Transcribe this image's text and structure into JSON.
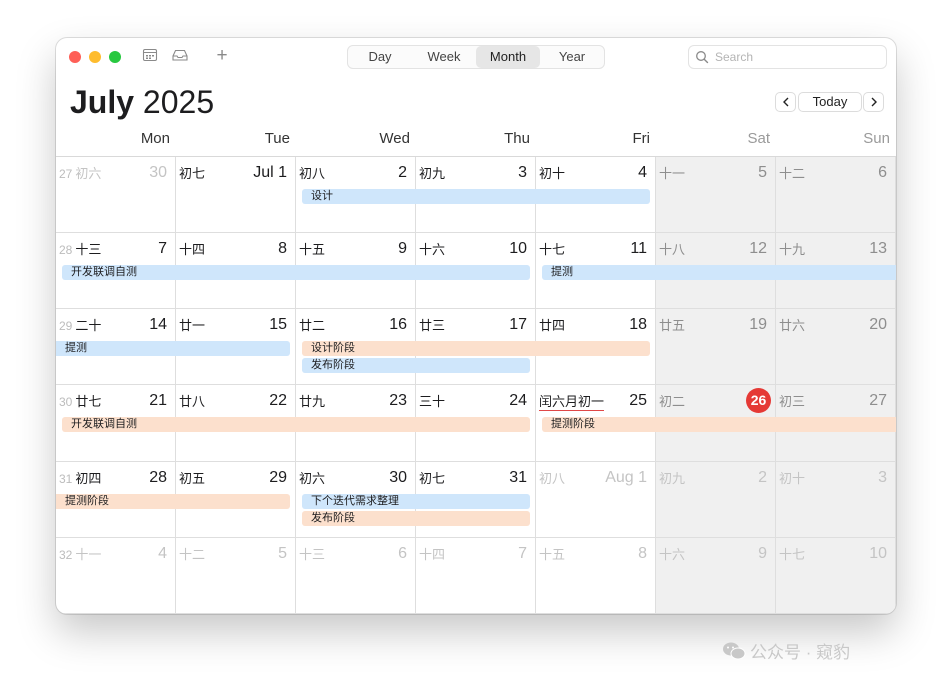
{
  "toolbar": {
    "views": [
      "Day",
      "Week",
      "Month",
      "Year"
    ],
    "active_view": "Month",
    "search_placeholder": "Search",
    "add_label": "+"
  },
  "header": {
    "month": "July",
    "year": "2025",
    "today_label": "Today"
  },
  "weekdays": [
    "Mon",
    "Tue",
    "Wed",
    "Thu",
    "Fri",
    "Sat",
    "Sun"
  ],
  "weeks": [
    {
      "week": "27",
      "days": [
        {
          "lunar": "初六",
          "day": "30",
          "faded": true
        },
        {
          "lunar": "初七",
          "day": "Jul 1"
        },
        {
          "lunar": "初八",
          "day": "2"
        },
        {
          "lunar": "初九",
          "day": "3"
        },
        {
          "lunar": "初十",
          "day": "4"
        },
        {
          "lunar": "十一",
          "day": "5"
        },
        {
          "lunar": "十二",
          "day": "6"
        }
      ]
    },
    {
      "week": "28",
      "days": [
        {
          "lunar": "十三",
          "day": "7"
        },
        {
          "lunar": "十四",
          "day": "8"
        },
        {
          "lunar": "十五",
          "day": "9"
        },
        {
          "lunar": "十六",
          "day": "10"
        },
        {
          "lunar": "十七",
          "day": "11"
        },
        {
          "lunar": "十八",
          "day": "12"
        },
        {
          "lunar": "十九",
          "day": "13"
        }
      ]
    },
    {
      "week": "29",
      "days": [
        {
          "lunar": "二十",
          "day": "14"
        },
        {
          "lunar": "廿一",
          "day": "15"
        },
        {
          "lunar": "廿二",
          "day": "16"
        },
        {
          "lunar": "廿三",
          "day": "17"
        },
        {
          "lunar": "廿四",
          "day": "18"
        },
        {
          "lunar": "廿五",
          "day": "19"
        },
        {
          "lunar": "廿六",
          "day": "20"
        }
      ]
    },
    {
      "week": "30",
      "days": [
        {
          "lunar": "廿七",
          "day": "21"
        },
        {
          "lunar": "廿八",
          "day": "22"
        },
        {
          "lunar": "廿九",
          "day": "23"
        },
        {
          "lunar": "三十",
          "day": "24"
        },
        {
          "lunar": "闰六月初一",
          "day": "25",
          "leap": true
        },
        {
          "lunar": "初二",
          "day": "26",
          "today": true
        },
        {
          "lunar": "初三",
          "day": "27"
        }
      ]
    },
    {
      "week": "31",
      "days": [
        {
          "lunar": "初四",
          "day": "28"
        },
        {
          "lunar": "初五",
          "day": "29"
        },
        {
          "lunar": "初六",
          "day": "30"
        },
        {
          "lunar": "初七",
          "day": "31"
        },
        {
          "lunar": "初八",
          "day": "Aug 1",
          "faded": true
        },
        {
          "lunar": "初九",
          "day": "2",
          "faded": true
        },
        {
          "lunar": "初十",
          "day": "3",
          "faded": true
        }
      ]
    },
    {
      "week": "32",
      "days": [
        {
          "lunar": "十一",
          "day": "4",
          "faded": true
        },
        {
          "lunar": "十二",
          "day": "5",
          "faded": true
        },
        {
          "lunar": "十三",
          "day": "6",
          "faded": true
        },
        {
          "lunar": "十四",
          "day": "7",
          "faded": true
        },
        {
          "lunar": "十五",
          "day": "8",
          "faded": true
        },
        {
          "lunar": "十六",
          "day": "9",
          "faded": true
        },
        {
          "lunar": "十七",
          "day": "10",
          "faded": true
        }
      ]
    }
  ],
  "events": [
    {
      "title": "设计",
      "week": 0,
      "start": 2,
      "end": 4,
      "lane": 0,
      "color": "#cfe6fb"
    },
    {
      "title": "开发联调自测",
      "week": 1,
      "start": 0,
      "end": 3,
      "lane": 0,
      "color": "#cfe6fb"
    },
    {
      "title": "提测",
      "week": 1,
      "start": 4,
      "end": 6,
      "lane": 0,
      "color": "#cfe6fb",
      "continues": true
    },
    {
      "title": "提测",
      "week": 2,
      "start": 0,
      "end": 1,
      "lane": 0,
      "color": "#cfe6fb",
      "continued": true
    },
    {
      "title": "设计阶段",
      "week": 2,
      "start": 2,
      "end": 4,
      "lane": 0,
      "color": "#fce0cd"
    },
    {
      "title": "发布阶段",
      "week": 2,
      "start": 2,
      "end": 3,
      "lane": 1,
      "color": "#cfe6fb"
    },
    {
      "title": "开发联调自测",
      "week": 3,
      "start": 0,
      "end": 3,
      "lane": 0,
      "color": "#fce0cd"
    },
    {
      "title": "提测阶段",
      "week": 3,
      "start": 4,
      "end": 6,
      "lane": 0,
      "color": "#fce0cd",
      "continues": true
    },
    {
      "title": "提测阶段",
      "week": 4,
      "start": 0,
      "end": 1,
      "lane": 0,
      "color": "#fce0cd",
      "continued": true
    },
    {
      "title": "下个迭代需求整理",
      "week": 4,
      "start": 2,
      "end": 3,
      "lane": 0,
      "color": "#cfe6fb"
    },
    {
      "title": "发布阶段",
      "week": 4,
      "start": 2,
      "end": 3,
      "lane": 1,
      "color": "#fce0cd"
    }
  ],
  "colors": {
    "today": "#e53935",
    "event_blue": "#cfe6fb",
    "event_orange": "#fce0cd",
    "weekend_bg": "#f0f0f0"
  },
  "watermark": {
    "text": "公众号 · 窥豹",
    "icon": "wechat-icon"
  }
}
